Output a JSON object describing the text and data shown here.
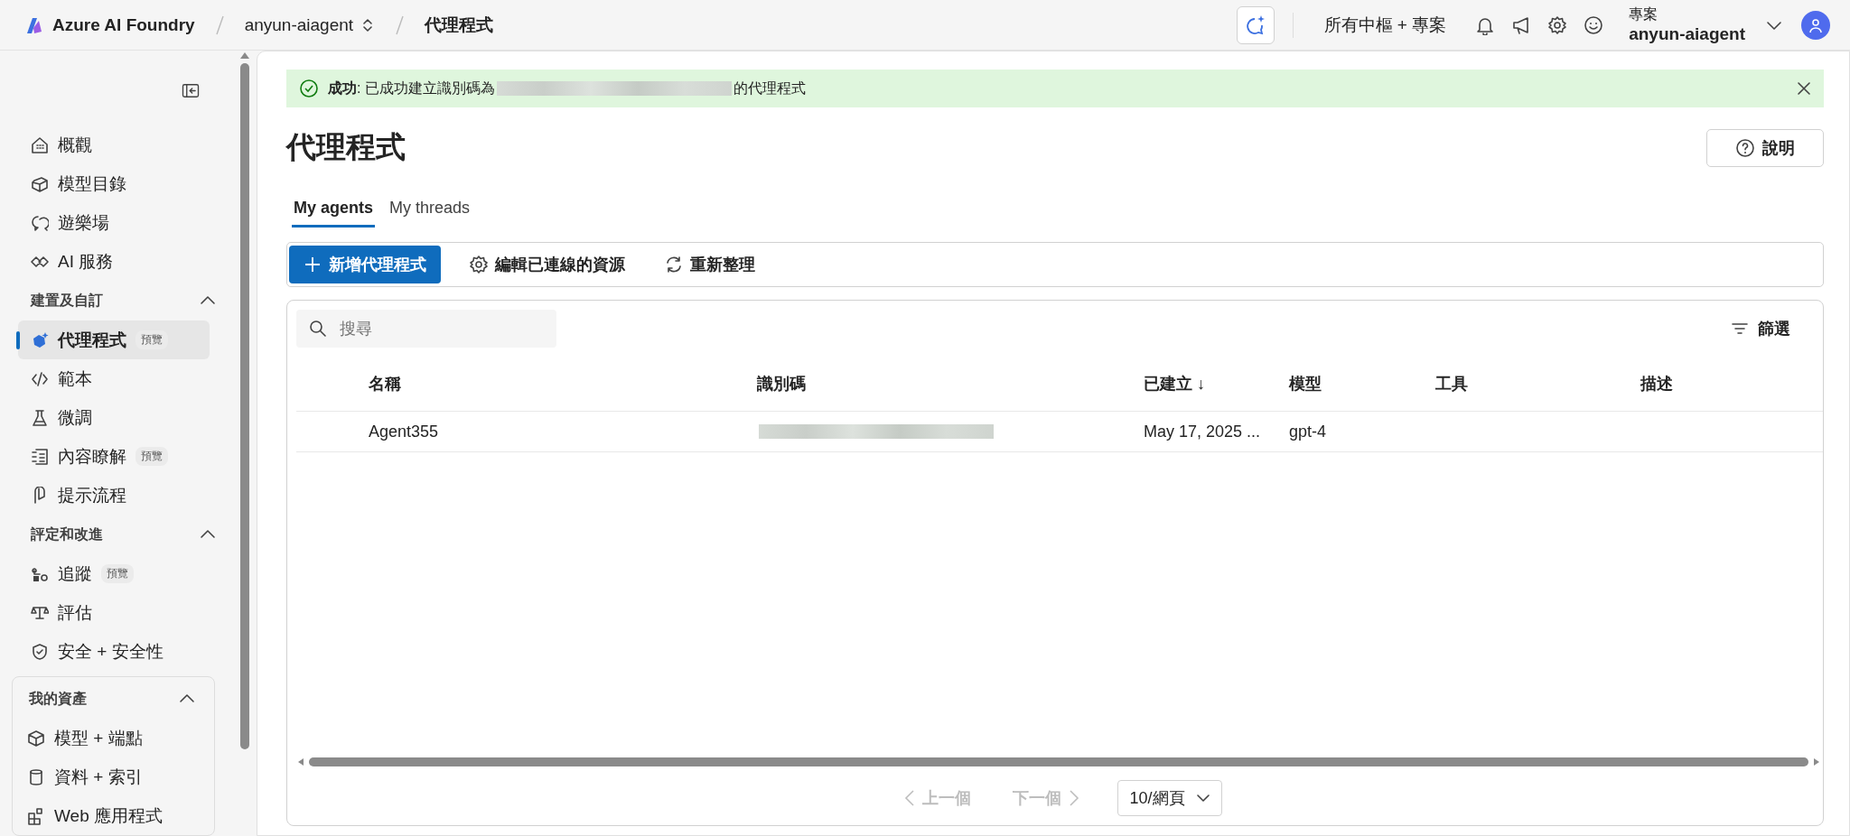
{
  "top_bar": {
    "brand": "Azure AI Foundry",
    "breadcrumbs": [
      {
        "label": "anyun-aiagent",
        "kind": "switcher"
      },
      {
        "label": "代理程式",
        "kind": "current"
      }
    ],
    "hub_link": "所有中樞 + 專案",
    "project_label": "專案",
    "project_name": "anyun-aiagent"
  },
  "sidebar": {
    "sections": [
      {
        "kind": "plain",
        "items": [
          {
            "label": "概觀",
            "selected": false
          },
          {
            "label": "模型目錄",
            "selected": false
          },
          {
            "label": "遊樂場",
            "selected": false
          },
          {
            "label": "AI 服務",
            "selected": false
          }
        ]
      },
      {
        "kind": "plain",
        "title": "建置及自訂",
        "expanded": true,
        "items": [
          {
            "label": "代理程式",
            "badge": "預覽",
            "selected": true
          },
          {
            "label": "範本",
            "selected": false
          },
          {
            "label": "微調",
            "selected": false
          },
          {
            "label": "內容瞭解",
            "badge": "預覽",
            "selected": false
          },
          {
            "label": "提示流程",
            "selected": false
          }
        ]
      },
      {
        "kind": "plain",
        "title": "評定和改進",
        "expanded": true,
        "items": [
          {
            "label": "追蹤",
            "badge": "預覽",
            "selected": false
          },
          {
            "label": "評估",
            "selected": false
          },
          {
            "label": "安全 + 安全性",
            "selected": false
          }
        ]
      },
      {
        "kind": "card",
        "title": "我的資產",
        "expanded": true,
        "items": [
          {
            "label": "模型 + 端點",
            "selected": false
          },
          {
            "label": "資料 + 索引",
            "selected": false
          },
          {
            "label": "Web 應用程式",
            "selected": false
          }
        ]
      }
    ]
  },
  "banner": {
    "kind": "success",
    "message_start": "**成功**: 已成功建立識別碼為",
    "identifier_hidden": true,
    "message_end": "的代理程式"
  },
  "page": {
    "title": "代理程式",
    "help_button": "說明"
  },
  "tabs": [
    {
      "label": "My agents",
      "selected": true
    },
    {
      "label": "My threads",
      "selected": false
    }
  ],
  "toolbar": {
    "primary_button": "新增代理程式",
    "edit_button": "編輯已連線的資源",
    "refresh_button": "重新整理"
  },
  "table": {
    "search": {
      "placeholder": "搜尋"
    },
    "filter_button": "篩選",
    "columns": [
      "名稱",
      "識別碼",
      "已建立 ↓",
      "模型",
      "工具",
      "描述"
    ],
    "rows": [
      {
        "name": "Agent355",
        "identifier_hidden": true,
        "created": "May 17, 2025 ...",
        "model": "gpt-4"
      }
    ]
  },
  "pagination": {
    "previous": {
      "label": "上一個",
      "disabled": true
    },
    "next": {
      "label": "下一個",
      "disabled": true
    },
    "page_size": "10/網頁"
  }
}
